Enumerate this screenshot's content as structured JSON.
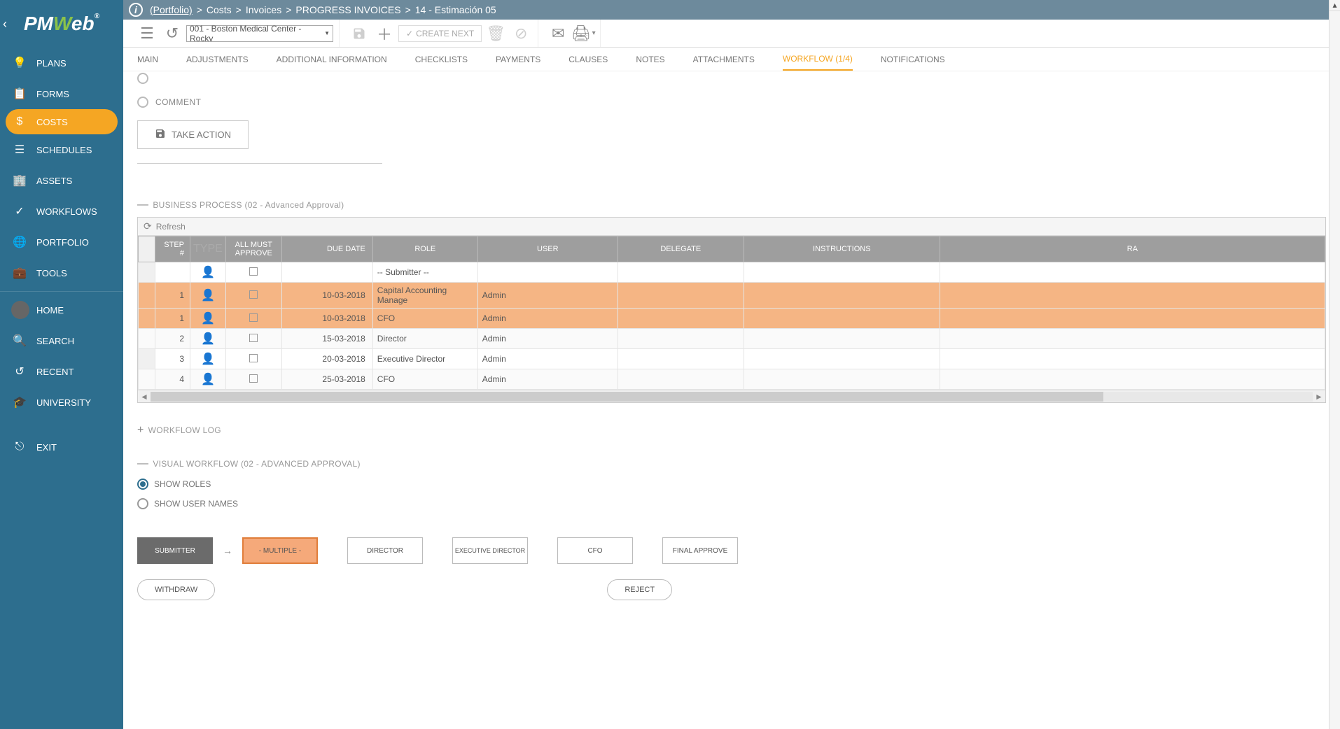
{
  "breadcrumb": {
    "portfolio": "(Portfolio)",
    "l1": "Costs",
    "l2": "Invoices",
    "l3": "PROGRESS INVOICES",
    "l4": "14 - Estimación 05"
  },
  "toolbar": {
    "project": "001 - Boston Medical Center - Rockv",
    "create_next": "CREATE NEXT"
  },
  "sidebar": {
    "items": [
      {
        "label": "PLANS"
      },
      {
        "label": "FORMS"
      },
      {
        "label": "COSTS"
      },
      {
        "label": "SCHEDULES"
      },
      {
        "label": "ASSETS"
      },
      {
        "label": "WORKFLOWS"
      },
      {
        "label": "PORTFOLIO"
      },
      {
        "label": "TOOLS"
      }
    ],
    "bottom": [
      {
        "label": "HOME"
      },
      {
        "label": "SEARCH"
      },
      {
        "label": "RECENT"
      },
      {
        "label": "UNIVERSITY"
      },
      {
        "label": "EXIT"
      }
    ]
  },
  "tabs": [
    {
      "label": "MAIN"
    },
    {
      "label": "ADJUSTMENTS"
    },
    {
      "label": "ADDITIONAL INFORMATION"
    },
    {
      "label": "CHECKLISTS"
    },
    {
      "label": "PAYMENTS"
    },
    {
      "label": "CLAUSES"
    },
    {
      "label": "NOTES"
    },
    {
      "label": "ATTACHMENTS"
    },
    {
      "label": "WORKFLOW (1/4)"
    },
    {
      "label": "NOTIFICATIONS"
    }
  ],
  "comment_label": "COMMENT",
  "take_action": "TAKE ACTION",
  "bp_header": "BUSINESS PROCESS (02 - Advanced Approval)",
  "refresh": "Refresh",
  "columns": {
    "step": "STEP #",
    "type": "TYPE",
    "approve": "ALL MUST APPROVE",
    "due": "DUE DATE",
    "role": "ROLE",
    "user": "USER",
    "delegate": "DELEGATE",
    "instructions": "INSTRUCTIONS",
    "ra": "RA"
  },
  "rows": [
    {
      "step": "",
      "due": "",
      "role": "-- Submitter --",
      "user": "",
      "hl": false
    },
    {
      "step": "1",
      "due": "10-03-2018",
      "role": "Capital Accounting Manage",
      "user": "Admin",
      "hl": true
    },
    {
      "step": "1",
      "due": "10-03-2018",
      "role": "CFO",
      "user": "Admin",
      "hl": true
    },
    {
      "step": "2",
      "due": "15-03-2018",
      "role": "Director",
      "user": "Admin",
      "hl": false
    },
    {
      "step": "3",
      "due": "20-03-2018",
      "role": "Executive Director",
      "user": "Admin",
      "hl": false
    },
    {
      "step": "4",
      "due": "25-03-2018",
      "role": "CFO",
      "user": "Admin",
      "hl": false
    }
  ],
  "workflow_log": "WORKFLOW LOG",
  "visual_wf_header": "VISUAL WORKFLOW (02 - ADVANCED APPROVAL)",
  "show_roles": "SHOW ROLES",
  "show_users": "SHOW USER NAMES",
  "flow": {
    "submitter": "SUBMITTER",
    "multiple": "- MULTIPLE -",
    "director": "DIRECTOR",
    "exec": "EXECUTIVE DIRECTOR",
    "cfo": "CFO",
    "final": "FINAL APPROVE"
  },
  "withdraw": "WITHDRAW",
  "reject": "REJECT"
}
